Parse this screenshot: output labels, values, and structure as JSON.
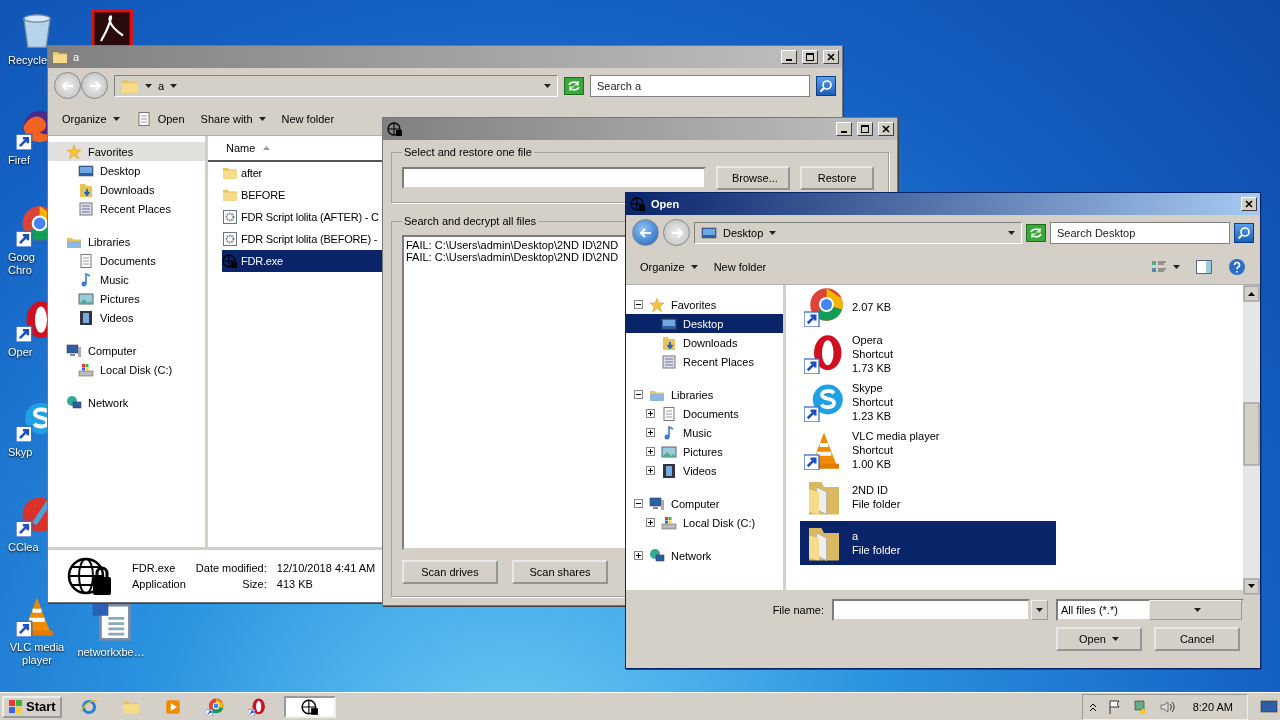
{
  "desktop_icons": [
    {
      "label": "Recycle"
    },
    {
      "label": "Firef"
    },
    {
      "label": "Goog Chro"
    },
    {
      "label": "Oper"
    },
    {
      "label": "Skyp"
    },
    {
      "label": "CClea"
    },
    {
      "label": "VLC media player"
    },
    {
      "label": "networkxbe…"
    }
  ],
  "explorer": {
    "title": "a",
    "breadcrumb": "a",
    "search": {
      "placeholder": "Search a"
    },
    "toolbar": [
      {
        "label": "Organize",
        "kind": "menu"
      },
      {
        "label": "Open",
        "kind": "icon"
      },
      {
        "label": "Share with",
        "kind": "menu"
      },
      {
        "label": "New folder",
        "kind": "plain"
      }
    ],
    "nav": [
      {
        "label": "Favorites",
        "kind": "star",
        "selected": true,
        "children": [
          {
            "label": "Desktop",
            "kind": "desktop",
            "selected": false
          },
          {
            "label": "Downloads",
            "kind": "downloads",
            "selected": false
          },
          {
            "label": "Recent Places",
            "kind": "recent",
            "selected": false
          }
        ]
      },
      {
        "label": "Libraries",
        "kind": "library",
        "selected": false,
        "children": [
          {
            "label": "Documents",
            "kind": "documents",
            "selected": false
          },
          {
            "label": "Music",
            "kind": "music",
            "selected": false
          },
          {
            "label": "Pictures",
            "kind": "pictures",
            "selected": false
          },
          {
            "label": "Videos",
            "kind": "videos",
            "selected": false
          }
        ]
      },
      {
        "label": "Computer",
        "kind": "computer",
        "selected": false,
        "children": [
          {
            "label": "Local Disk (C:)",
            "kind": "disk",
            "selected": false
          }
        ]
      },
      {
        "label": "Network",
        "kind": "network",
        "selected": false
      }
    ],
    "column": "Name",
    "files": [
      {
        "name": "after",
        "kind": "folder",
        "selected": false
      },
      {
        "name": "BEFORE",
        "kind": "folder",
        "selected": false
      },
      {
        "name": "FDR Script lolita (AFTER) - C",
        "kind": "script",
        "selected": false
      },
      {
        "name": "FDR Script lolita (BEFORE) -",
        "kind": "script",
        "selected": false
      },
      {
        "name": "FDR.exe",
        "kind": "app",
        "selected": true
      }
    ],
    "details": {
      "name": "FDR.exe",
      "type": "Application",
      "modified_label": "Date modified:",
      "modified": "12/10/2018 4:41 AM",
      "size_label": "Size:",
      "size": "413 KB"
    }
  },
  "restore": {
    "restore_group": "Select and restore one file",
    "browse": "Browse...",
    "restore": "Restore",
    "decrypt_group": "Search and decrypt all files",
    "log": [
      "FAIL: C:\\Users\\admin\\Desktop\\2ND ID\\2ND",
      "FAIL: C:\\Users\\admin\\Desktop\\2ND ID\\2ND"
    ],
    "buttons": [
      "Scan drives",
      "Scan shares"
    ]
  },
  "open_dialog": {
    "title": "Open",
    "location": "Desktop",
    "search": {
      "placeholder": "Search Desktop"
    },
    "toolbar": [
      "Organize",
      "New folder"
    ],
    "tree": [
      {
        "label": "Favorites",
        "kind": "star",
        "expanded": true,
        "selected": false,
        "children": [
          {
            "label": "Desktop",
            "kind": "desktop",
            "selected": true
          },
          {
            "label": "Downloads",
            "kind": "downloads",
            "selected": false
          },
          {
            "label": "Recent Places",
            "kind": "recent",
            "selected": false
          }
        ]
      },
      {
        "label": "Libraries",
        "kind": "library",
        "expanded": true,
        "selected": false,
        "children": [
          {
            "label": "Documents",
            "kind": "documents",
            "expanded": false,
            "selected": false
          },
          {
            "label": "Music",
            "kind": "music",
            "expanded": false,
            "selected": false
          },
          {
            "label": "Pictures",
            "kind": "pictures",
            "expanded": false,
            "selected": false
          },
          {
            "label": "Videos",
            "kind": "videos",
            "expanded": false,
            "selected": false
          }
        ]
      },
      {
        "label": "Computer",
        "kind": "computer",
        "expanded": true,
        "selected": false,
        "children": [
          {
            "label": "Local Disk (C:)",
            "kind": "disk",
            "expanded": false,
            "selected": false
          }
        ]
      },
      {
        "label": "Network",
        "kind": "network",
        "expanded": false,
        "selected": false
      }
    ],
    "files": [
      {
        "kind": "chrome",
        "lines": [
          "2.07 KB"
        ],
        "selected": false
      },
      {
        "kind": "opera",
        "lines": [
          "Opera",
          "Shortcut",
          "1.73 KB"
        ],
        "selected": false
      },
      {
        "kind": "skype",
        "lines": [
          "Skype",
          "Shortcut",
          "1.23 KB"
        ],
        "selected": false
      },
      {
        "kind": "vlc",
        "lines": [
          "VLC media player",
          "Shortcut",
          "1.00 KB"
        ],
        "selected": false
      },
      {
        "kind": "bigfolder",
        "lines": [
          "2ND ID",
          "File folder"
        ],
        "selected": false
      },
      {
        "kind": "bigfolder",
        "lines": [
          "a",
          "File folder"
        ],
        "selected": true
      }
    ],
    "file_name_label": "File name:",
    "filter": "All files (*.*)",
    "buttons": [
      "Open",
      "Cancel"
    ]
  },
  "taskbar": {
    "start": "Start",
    "apps": [
      {
        "selected": false
      },
      {
        "selected": false
      },
      {
        "selected": false
      },
      {
        "selected": false
      },
      {
        "selected": false
      },
      {
        "selected": true
      }
    ],
    "clock": "8:20 AM"
  }
}
